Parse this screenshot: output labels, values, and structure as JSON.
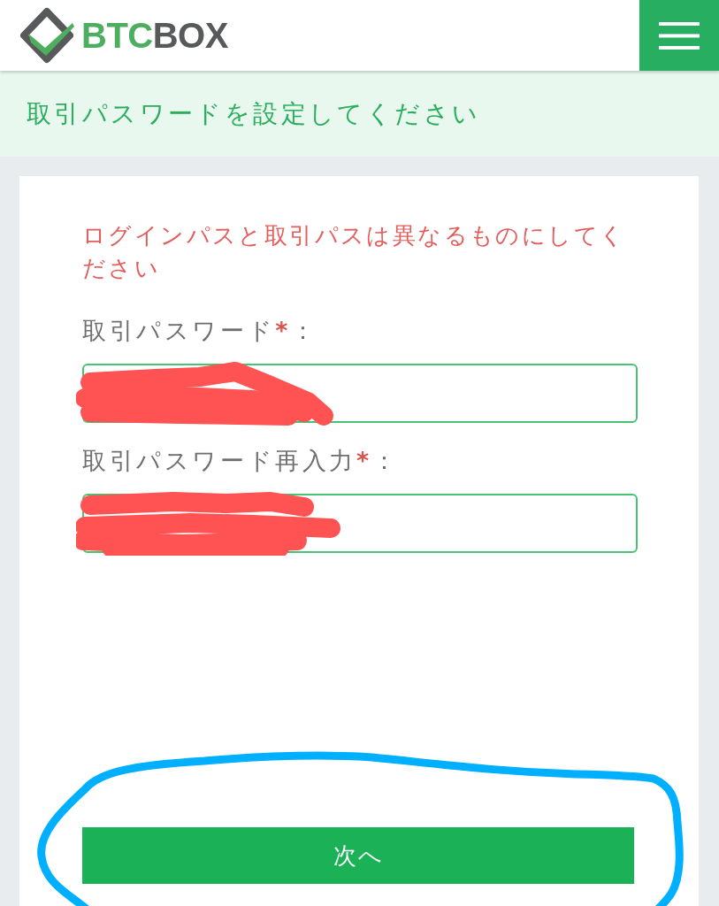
{
  "header": {
    "logo": {
      "part_1": "BTC",
      "part_2": "BOX"
    }
  },
  "banner": {
    "title": "取引パスワードを設定してください"
  },
  "form": {
    "error": "ログインパスと取引パスは異なるものにしてください",
    "fields": [
      {
        "label": "取引パスワード",
        "required_mark": "*",
        "colon": "：",
        "redacted": true
      },
      {
        "label": "取引パスワード再入力",
        "required_mark": "*",
        "colon": "：",
        "redacted": true
      }
    ],
    "submit": {
      "label": "次へ",
      "circled": true
    }
  }
}
